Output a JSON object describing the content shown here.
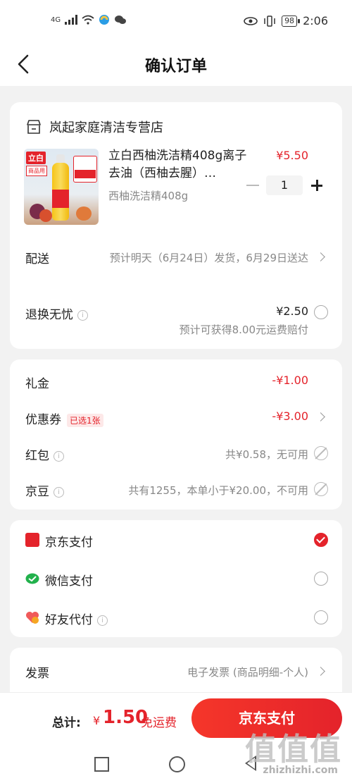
{
  "status_bar": {
    "network": "4G",
    "battery": "98",
    "time": "2:06"
  },
  "nav": {
    "title": "确认订单"
  },
  "store": {
    "name": "岚起家庭清洁专营店",
    "product": {
      "title": "立白西柚洗洁精408g离子去油（西柚去腥）…",
      "spec": "西柚洗洁精408g",
      "price": "¥5.50",
      "quantity": "1",
      "image_text": {
        "brand": "立白",
        "sub": "商品用"
      }
    },
    "delivery": {
      "label": "配送",
      "value": "预计明天（6月24日）发货，6月29日送达"
    },
    "return_insurance": {
      "label": "退换无忧",
      "price": "¥2.50",
      "note": "预计可获得8.00元运费赔付",
      "checked": false
    }
  },
  "discounts": {
    "gift_money": {
      "label": "礼金",
      "value": "-¥1.00"
    },
    "coupon": {
      "label": "优惠券",
      "badge": "已选1张",
      "value": "-¥3.00"
    },
    "red_packet": {
      "label": "红包",
      "value": "共¥0.58，无可用"
    },
    "jingdou": {
      "label": "京豆",
      "value": "共有1255，本单小于¥20.00，不可用"
    }
  },
  "payment": {
    "options": [
      {
        "label": "京东支付",
        "icon": "jd-pay-icon",
        "selected": true,
        "color": "#e4232b"
      },
      {
        "label": "微信支付",
        "icon": "wechat-pay-icon",
        "selected": false,
        "color": "#22b14c"
      },
      {
        "label": "好友代付",
        "icon": "friend-pay-icon",
        "selected": false,
        "color": "#f05a5a"
      }
    ]
  },
  "invoice": {
    "label": "发票",
    "value": "电子发票 (商品明细-个人)"
  },
  "bottom": {
    "total_label": "总计:",
    "currency": "¥",
    "amount": "1.50",
    "shipping": "免运费",
    "pay_button": "京东支付"
  },
  "watermark": {
    "big": "值值值",
    "small": "zhizhizhi.com"
  },
  "colors": {
    "accent": "#e4232b",
    "background": "#f2f2f2"
  }
}
